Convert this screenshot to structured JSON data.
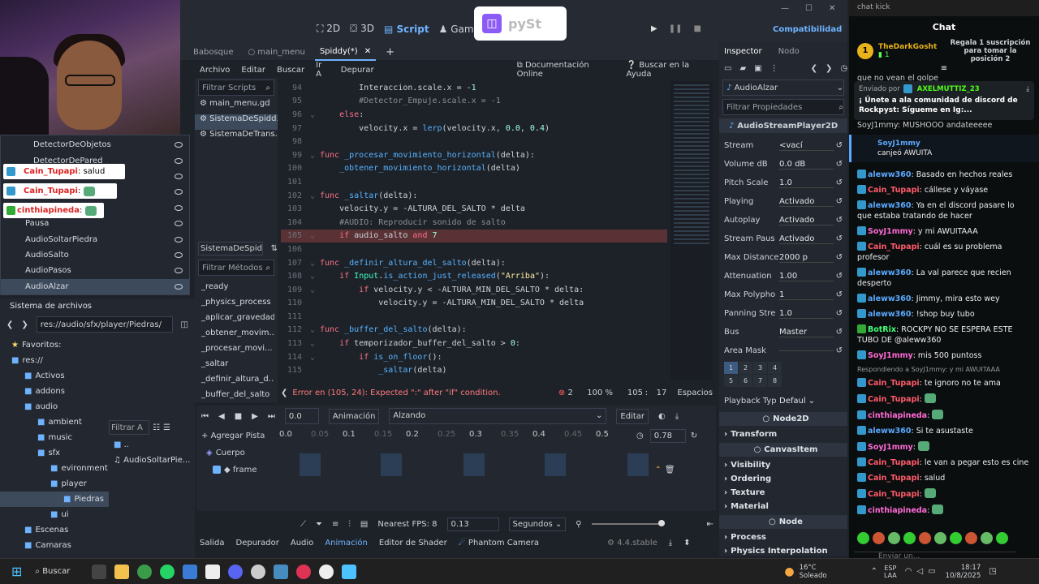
{
  "topbar": {
    "mode_2d": "2D",
    "mode_3d": "3D",
    "mode_script": "Script",
    "mode_game": "Game",
    "renderer": "Compatibilidad",
    "overlay_text": "pySt"
  },
  "script_tabs": [
    "Babosque",
    "main_menu",
    "Spiddy(*)"
  ],
  "script_menu": {
    "file": "Archivo",
    "edit": "Editar",
    "search": "Buscar",
    "goto": "Ir A",
    "debug": "Depurar",
    "online_docs": "Documentación Online",
    "search_help": "Buscar en la Ayuda"
  },
  "filter_scripts_placeholder": "Filtrar Scripts",
  "scripts": [
    "main_menu.gd",
    "SistemaDeSpidd...",
    "SistemaDeTrans..."
  ],
  "current_script_label": "SistemaDeSpiddy",
  "filter_methods_placeholder": "Filtrar Métodos",
  "methods": [
    "_ready",
    "_physics_process",
    "_aplicar_gravedad",
    "_obtener_movim...",
    "_procesar_movi...",
    "_saltar",
    "_definir_altura_d...",
    "_buffer_del_salto"
  ],
  "scene_tree": {
    "items": [
      "DetectorDeObjetos",
      "DetectorDePared",
      "",
      "",
      "",
      "Pausa",
      "AudioSoltarPiedra",
      "AudioSalto",
      "AudioPasos",
      "AudioAlzar"
    ]
  },
  "overlay_chat": [
    {
      "user": "Cain_Tupapi",
      "msg": ": salud"
    },
    {
      "user": "Cain_Tupapi",
      "msg": ":"
    },
    {
      "user": "cinthiapineda",
      "msg": ":"
    }
  ],
  "filesystem": {
    "title": "Sistema de archivos",
    "path": "res://audio/sfx/player/Piedras/",
    "favorites": "Favoritos:",
    "tree": [
      "res://",
      "Activos",
      "addons",
      "audio",
      "ambient",
      "music",
      "sfx",
      "evironment",
      "player",
      "Piedras",
      "ui",
      "Escenas",
      "Camaras"
    ],
    "filter_placeholder": "Filtrar A",
    "files": [
      "..",
      "AudioSoltarPie..."
    ]
  },
  "code": {
    "line_numbers": [
      "94",
      "95",
      "96",
      "97",
      "98",
      "99",
      "100",
      "101",
      "102",
      "103",
      "104",
      "105",
      "106",
      "107",
      "108",
      "109",
      "110",
      "111",
      "112",
      "113",
      "114",
      "115"
    ],
    "lines": [
      "        Interaccion.scale.x = -1",
      "        #Detector_Empuje.scale.x = -1",
      "    else:",
      "        velocity.x = lerp(velocity.x, 0.0, 0.4)",
      "",
      "func _procesar_movimiento_horizontal(delta):",
      "    _obtener_movimiento_horizontal(delta)",
      "",
      "func _saltar(delta):",
      "    velocity.y = -ALTURA_DEL_SALTO * delta",
      "    #AUDIO: Reproducir sonido de salto",
      "    if audio_salto and 7",
      "",
      "func _definir_altura_del_salto(delta):",
      "    if Input.is_action_just_released(\"Arriba\"):",
      "        if velocity.y < -ALTURA_MIN_DEL_SALTO * delta:",
      "            velocity.y = -ALTURA_MIN_DEL_SALTO * delta",
      "",
      "func _buffer_del_salto(delta):",
      "    if temporizador_buffer_del_salto > 0:",
      "        if is_on_floor():",
      "            _saltar(delta)"
    ]
  },
  "status": {
    "error": "Error en (105, 24): Expected \":\" after \"if\" condition.",
    "error_count": "2",
    "zoom": "100 %",
    "line": "105",
    "col": "17",
    "spaces": "Espacios"
  },
  "animation": {
    "time": "0.0",
    "anim_label": "Animación",
    "anim_name": "Alzando",
    "edit": "Editar",
    "add_track": "Agregar Pista",
    "ruler": [
      "0.0",
      "0.05",
      "0.1",
      "0.15",
      "0.2",
      "0.25",
      "0.3",
      "0.35",
      "0.4",
      "0.45",
      "0.5"
    ],
    "length": "0.78",
    "track_group": "Cuerpo",
    "track": "frame",
    "fps_label": "Nearest FPS: 8",
    "snap": "0.13",
    "unit": "Segundos"
  },
  "bottom_tabs": [
    "Salida",
    "Depurador",
    "Audio",
    "Animación",
    "Editor de Shader",
    "Phantom Camera"
  ],
  "version": "4.4.stable",
  "inspector": {
    "tabs": [
      "Inspector",
      "Nodo"
    ],
    "node": "AudioAlzar",
    "filter_placeholder": "Filtrar Propiedades",
    "class": "AudioStreamPlayer2D",
    "props": [
      {
        "label": "Stream",
        "value": "<vací"
      },
      {
        "label": "Volume dB",
        "value": "0.0 dB"
      },
      {
        "label": "Pitch Scale",
        "value": "1.0"
      },
      {
        "label": "Playing",
        "value": "Activado"
      },
      {
        "label": "Autoplay",
        "value": "Activado"
      },
      {
        "label": "Stream Paus",
        "value": "Activado"
      },
      {
        "label": "Max Distance",
        "value": "2000 p"
      },
      {
        "label": "Attenuation",
        "value": "1.00"
      },
      {
        "label": "Max Polypho",
        "value": "1"
      },
      {
        "label": "Panning Stre",
        "value": "1.0"
      },
      {
        "label": "Bus",
        "value": "Master"
      },
      {
        "label": "Area Mask",
        "value": ""
      }
    ],
    "mask_cells": [
      "1",
      "2",
      "3",
      "4",
      "5",
      "6",
      "7",
      "8"
    ],
    "playback_label": "Playback Typ",
    "playback_value": "Defaul",
    "sections": [
      "Node2D",
      "Transform",
      "CanvasItem",
      "Visibility",
      "Ordering",
      "Texture",
      "Material",
      "Node",
      "Process",
      "Physics Interpolation"
    ]
  },
  "chat": {
    "window_title": "chat kick",
    "title": "Chat",
    "gift_user": "TheDarkGosht",
    "gift_count": "1",
    "gift_text": "Regala 1 suscripción para tomar la posición 2",
    "pinned_prefix": "Enviado por",
    "pinned_user": "AXELMUTTIZ_23",
    "pinned_msg": "¡ Únete a ala comunidad de discord de Rockpyst: Sígueme en Ig:...",
    "top_partial": "que no vean el golpe",
    "partial2": "SoyJ1mmy: MUSHOOO andateeeee andateeee",
    "highlight_user": "SoyJ1mmy",
    "highlight_msg": "canjeó AWUITA",
    "reply_to": "Respondiendo a SoyJ1mmy: y mi AWUITAAA",
    "messages": [
      {
        "user": "aleww360",
        "color": "#5aa9ff",
        "msg": ": Basado en hechos reales"
      },
      {
        "user": "Cain_Tupapi",
        "color": "#ff5a6a",
        "msg": ": cállese y váyase"
      },
      {
        "user": "aleww360",
        "color": "#5aa9ff",
        "msg": ": Ya en el discord pasare lo que estaba tratando de hacer"
      },
      {
        "user": "SoyJ1mmy",
        "color": "#ff6ad5",
        "msg": ": y mi AWUITAAA"
      },
      {
        "user": "Cain_Tupapi",
        "color": "#ff5a6a",
        "msg": ": cuál es su problema profesor"
      },
      {
        "user": "aleww360",
        "color": "#5aa9ff",
        "msg": ": La val parece que recien desperto"
      },
      {
        "user": "aleww360",
        "color": "#5aa9ff",
        "msg": ": Jimmy, mira esto wey"
      },
      {
        "user": "aleww360",
        "color": "#5aa9ff",
        "msg": ": !shop buy tubo"
      },
      {
        "user": "BotRix",
        "color": "#44ff77",
        "msg": ": ROCKPY NO SE ESPERA ESTE TUBO DE @aleww360"
      },
      {
        "user": "SoyJ1mmy",
        "color": "#ff6ad5",
        "msg": ": mis 500 puntoss"
      },
      {
        "user": "Cain_Tupapi",
        "color": "#ff5a6a",
        "msg": ": te ignoro no te ama"
      },
      {
        "user": "Cain_Tupapi",
        "color": "#ff5a6a",
        "msg": ":"
      },
      {
        "user": "cinthiapineda",
        "color": "#ff6ad5",
        "msg": ":"
      },
      {
        "user": "aleww360",
        "color": "#5aa9ff",
        "msg": ": Si te asustaste"
      },
      {
        "user": "SoyJ1mmy",
        "color": "#ff6ad5",
        "msg": ":"
      },
      {
        "user": "Cain_Tupapi",
        "color": "#ff5a6a",
        "msg": ": le van a pegar esto es cine"
      },
      {
        "user": "Cain_Tupapi",
        "color": "#ff5a6a",
        "msg": ": salud"
      },
      {
        "user": "Cain_Tupapi",
        "color": "#ff5a6a",
        "msg": ":"
      },
      {
        "user": "cinthiapineda",
        "color": "#ff6ad5",
        "msg": ":"
      }
    ],
    "input_placeholder": "Enviar un..."
  },
  "taskbar": {
    "search": "Buscar",
    "weather_temp": "16°C",
    "weather_text": "Soleado",
    "lang1": "ESP",
    "lang2": "LAA",
    "time": "18:17",
    "date": "10/8/2025"
  }
}
